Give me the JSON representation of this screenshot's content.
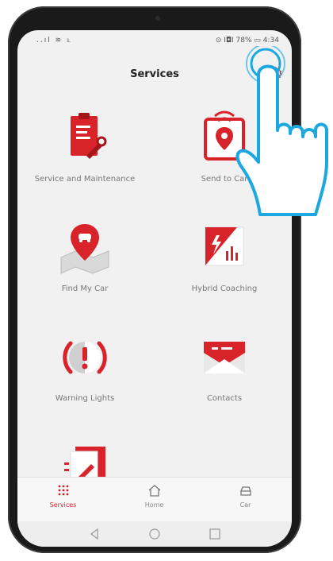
{
  "status": {
    "signal": "..ıl ≋ ೩",
    "battery": "⊙ I◘I 78% ▭ 4:34"
  },
  "header": {
    "title": "Services"
  },
  "services": [
    {
      "label": "Service and Maintenance",
      "icon": "clipboard-wrench-icon"
    },
    {
      "label": "Send to Car",
      "icon": "phone-location-pin-icon"
    },
    {
      "label": "Find My Car",
      "icon": "map-car-pin-icon"
    },
    {
      "label": "Hybrid Coaching",
      "icon": "hybrid-chart-icon"
    },
    {
      "label": "Warning Lights",
      "icon": "warning-exclamation-icon"
    },
    {
      "label": "Contacts",
      "icon": "envelope-icon"
    }
  ],
  "tabs": [
    {
      "label": "Services",
      "icon": "grid-dots-icon",
      "active": true
    },
    {
      "label": "Home",
      "icon": "home-icon",
      "active": false
    },
    {
      "label": "Car",
      "icon": "car-icon",
      "active": false
    }
  ],
  "colors": {
    "accent": "#d9232a",
    "highlight": "#1ba8e0"
  }
}
